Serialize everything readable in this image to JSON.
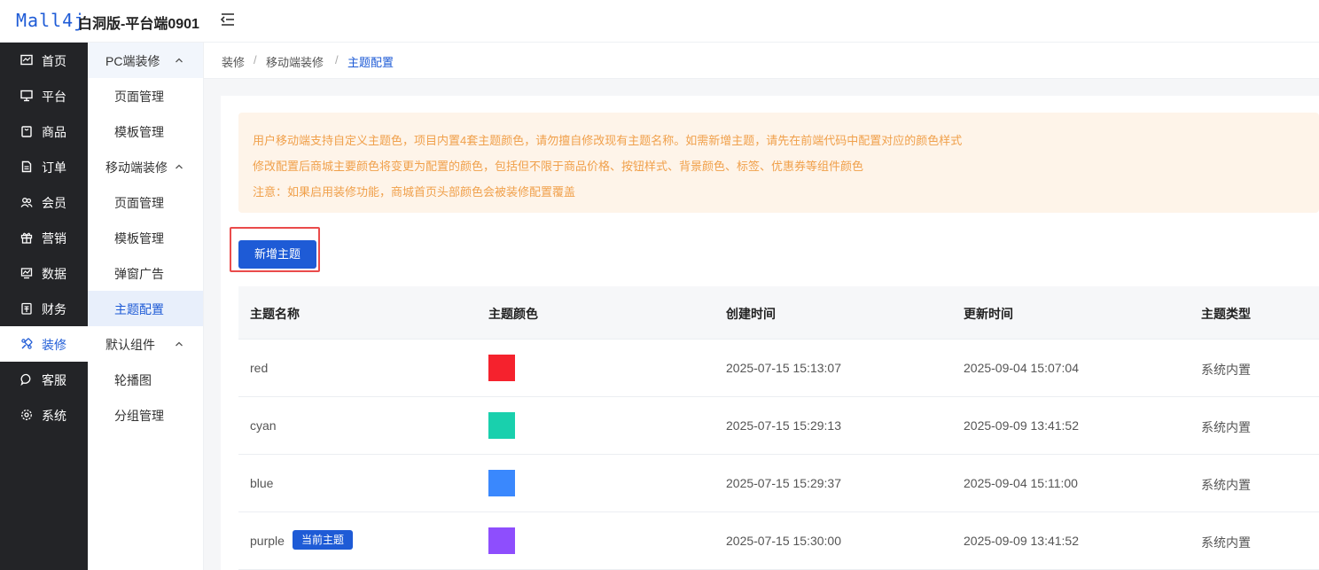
{
  "header": {
    "logo_text": "Mall4j",
    "title": "白洞版-平台端0901"
  },
  "main_nav": [
    {
      "label": "首页",
      "icon": "monitor-icon"
    },
    {
      "label": "平台",
      "icon": "desktop-icon"
    },
    {
      "label": "商品",
      "icon": "bag-icon"
    },
    {
      "label": "订单",
      "icon": "document-icon"
    },
    {
      "label": "会员",
      "icon": "users-icon"
    },
    {
      "label": "营销",
      "icon": "gift-icon"
    },
    {
      "label": "数据",
      "icon": "chart-icon"
    },
    {
      "label": "财务",
      "icon": "finance-icon"
    },
    {
      "label": "装修",
      "icon": "decorate-icon",
      "active": true
    },
    {
      "label": "客服",
      "icon": "chat-icon"
    },
    {
      "label": "系统",
      "icon": "settings-icon"
    }
  ],
  "sub_nav": {
    "groups": [
      {
        "label": "PC端装修",
        "items": [
          "页面管理",
          "模板管理"
        ]
      },
      {
        "label": "移动端装修",
        "items": [
          "页面管理",
          "模板管理",
          "弹窗广告",
          "主题配置"
        ]
      },
      {
        "label": "默认组件",
        "items": [
          "轮播图",
          "分组管理"
        ]
      }
    ],
    "active_item": "主题配置"
  },
  "breadcrumb": [
    "装修",
    "移动端装修",
    "主题配置"
  ],
  "notice": {
    "lines": [
      "用户移动端支持自定义主题色，项目内置4套主题颜色，请勿擅自修改现有主题名称。如需新增主题，请先在前端代码中配置对应的颜色样式",
      "修改配置后商城主要颜色将变更为配置的颜色，包括但不限于商品价格、按钮样式、背景颜色、标签、优惠券等组件颜色",
      "注意：如果启用装修功能，商城首页头部颜色会被装修配置覆盖"
    ]
  },
  "add_button_label": "新增主题",
  "table": {
    "headers": [
      "主题名称",
      "主题颜色",
      "创建时间",
      "更新时间",
      "主题类型"
    ],
    "rows": [
      {
        "name": "red",
        "color": "#f5222d",
        "created": "2025-07-15 15:13:07",
        "updated": "2025-09-04 15:07:04",
        "type": "系统内置",
        "badge": ""
      },
      {
        "name": "cyan",
        "color": "#19d0ad",
        "created": "2025-07-15 15:29:13",
        "updated": "2025-09-09 13:41:52",
        "type": "系统内置",
        "badge": ""
      },
      {
        "name": "blue",
        "color": "#3a88fd",
        "created": "2025-07-15 15:29:37",
        "updated": "2025-09-04 15:11:00",
        "type": "系统内置",
        "badge": ""
      },
      {
        "name": "purple",
        "color": "#8e4efd",
        "created": "2025-07-15 15:30:00",
        "updated": "2025-09-09 13:41:52",
        "type": "系统内置",
        "badge": "当前主题"
      }
    ]
  },
  "colors": {
    "accent": "#1e5bd6",
    "nav_bg": "#232427",
    "notice_bg": "#fef4e9",
    "notice_text": "#f0a04b",
    "highlight": "#ea4b4b"
  }
}
